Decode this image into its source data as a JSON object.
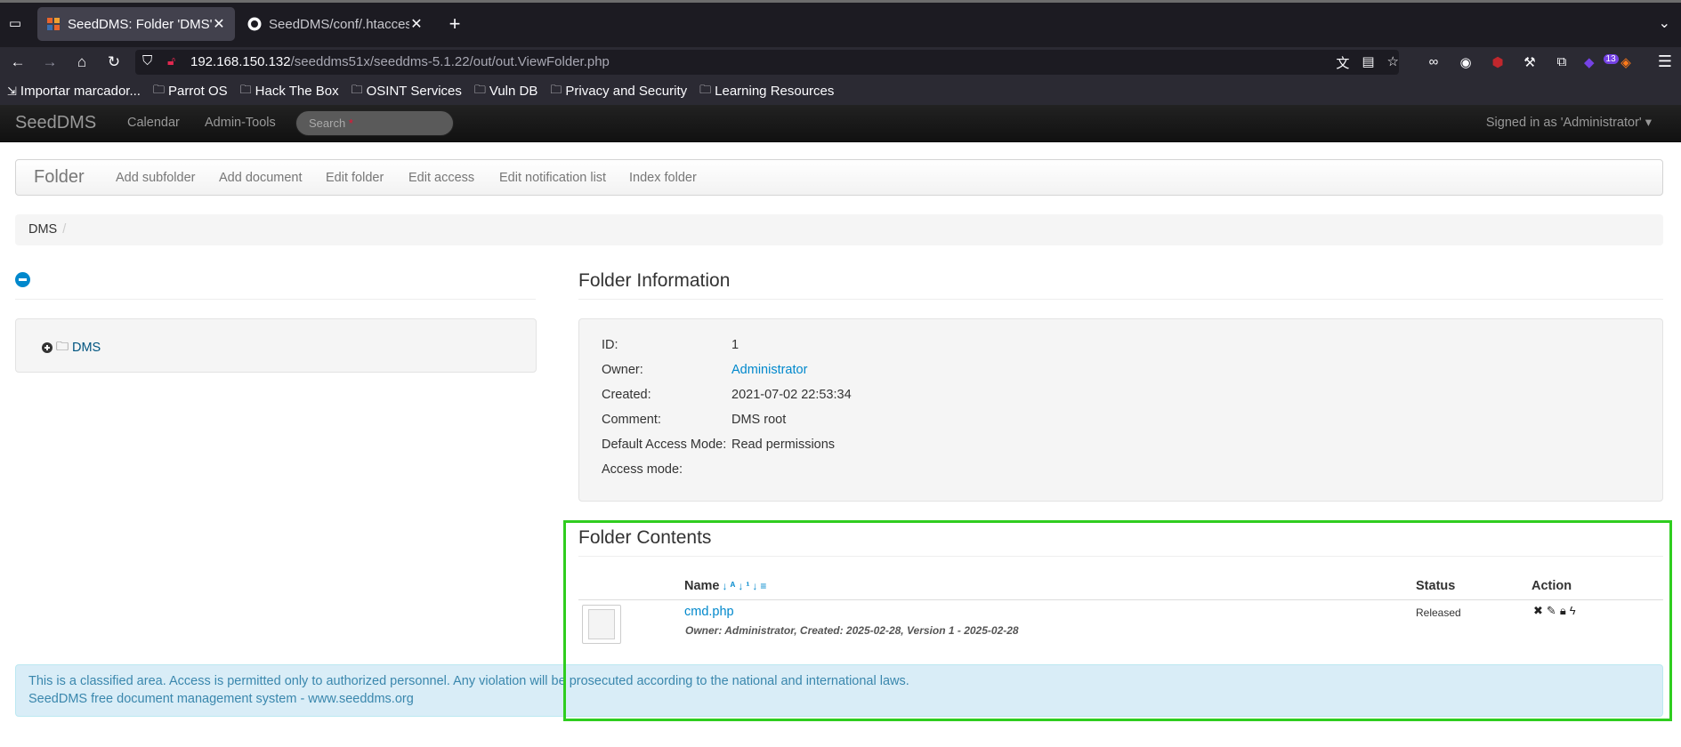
{
  "browser": {
    "tabs": [
      {
        "title": "SeedDMS: Folder 'DMS'",
        "active": true
      },
      {
        "title": "SeedDMS/conf/.htaccess",
        "active": false
      }
    ],
    "url_host": "192.168.150.132",
    "url_path": "/seeddms51x/seeddms-5.1.22/out/out.ViewFolder.php",
    "extension_badge": "13",
    "bookmarks": [
      {
        "label": "Importar marcador...",
        "icon": "import-icon"
      },
      {
        "label": "Parrot OS",
        "icon": "folder-icon"
      },
      {
        "label": "Hack The Box",
        "icon": "folder-icon"
      },
      {
        "label": "OSINT Services",
        "icon": "folder-icon"
      },
      {
        "label": "Vuln DB",
        "icon": "folder-icon"
      },
      {
        "label": "Privacy and Security",
        "icon": "folder-icon"
      },
      {
        "label": "Learning Resources",
        "icon": "folder-icon"
      }
    ]
  },
  "app": {
    "brand": "SeedDMS",
    "topnav": [
      "Calendar",
      "Admin-Tools"
    ],
    "search_placeholder": "Search",
    "signed_in": "Signed in as 'Administrator'"
  },
  "subnav": {
    "title": "Folder",
    "items": [
      "Add subfolder",
      "Add document",
      "Edit folder",
      "Edit access",
      "Edit notification list",
      "Index folder"
    ]
  },
  "breadcrumb": {
    "root": "DMS",
    "separator": "/"
  },
  "tree": {
    "root_label": "DMS"
  },
  "folder_info": {
    "heading": "Folder Information",
    "rows": [
      {
        "key": "ID:",
        "value": "1"
      },
      {
        "key": "Owner:",
        "value": "Administrator"
      },
      {
        "key": "Created:",
        "value": "2021-07-02 22:53:34"
      },
      {
        "key": "Comment:",
        "value": "DMS root"
      },
      {
        "key": "Default Access Mode:",
        "value": "Read permissions"
      },
      {
        "key": "Access mode:",
        "value": ""
      }
    ]
  },
  "folder_contents": {
    "heading": "Folder Contents",
    "columns": {
      "name": "Name",
      "status": "Status",
      "action": "Action"
    },
    "documents": [
      {
        "name": "cmd.php",
        "meta": "Owner: Administrator, Created: 2025-02-28, Version 1 - 2025-02-28",
        "status": "Released"
      }
    ]
  },
  "footer": {
    "line1": "This is a classified area. Access is permitted only to authorized personnel. Any violation will be prosecuted according to the national and international laws.",
    "line2": "SeedDMS free document management system - www.seeddms.org"
  },
  "colors": {
    "highlight": "#2fcd1f",
    "link": "#0088cc",
    "alert_bg": "#d9edf7"
  }
}
